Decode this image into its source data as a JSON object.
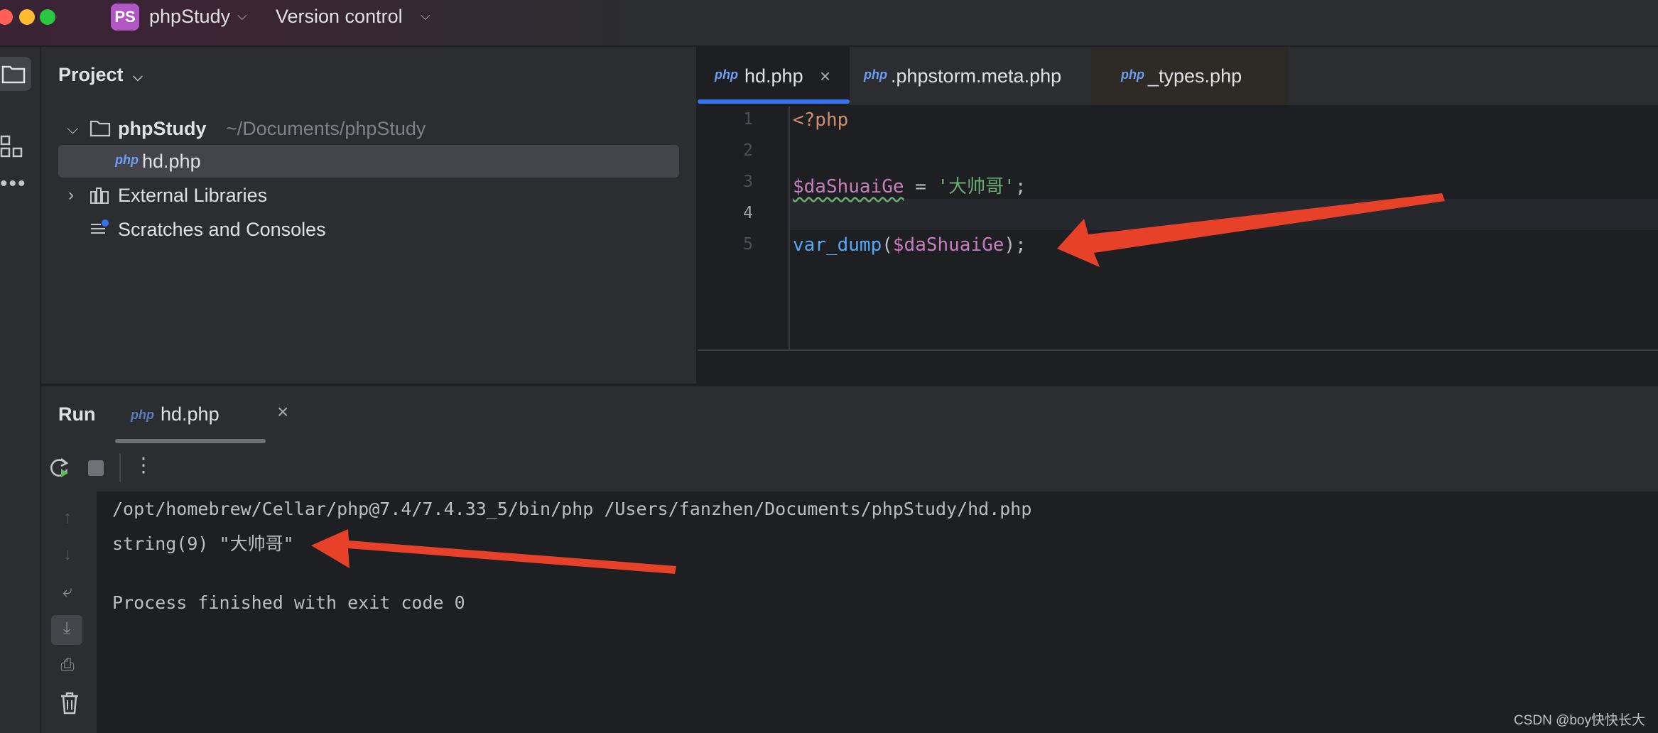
{
  "titlebar": {
    "project_badge": "PS",
    "project_name": "phpStudy",
    "vcs": "Version control"
  },
  "project_panel": {
    "title": "Project",
    "tree": {
      "root_name": "phpStudy",
      "root_path": "~/Documents/phpStudy",
      "file": "hd.php",
      "external": "External Libraries",
      "scratches": "Scratches and Consoles"
    }
  },
  "editor": {
    "tabs": [
      {
        "label": "hd.php",
        "active": true
      },
      {
        "label": ".phpstorm.meta.php",
        "active": false
      },
      {
        "label": "_types.php",
        "active": false
      }
    ],
    "file_icon_text": "php",
    "line_numbers": [
      "1",
      "2",
      "3",
      "4",
      "5"
    ],
    "code": {
      "line1": "<?php",
      "line3_var": "$daShuaiGe",
      "line3_op": " = ",
      "line3_str": "'大帅哥'",
      "line3_semi": ";",
      "line5_fn": "var_dump",
      "line5_open": "(",
      "line5_var": "$daShuaiGe",
      "line5_close": ");"
    }
  },
  "run_panel": {
    "title": "Run",
    "tab_label": "hd.php",
    "output": [
      "/opt/homebrew/Cellar/php@7.4/7.4.33_5/bin/php /Users/fanzhen/Documents/phpStudy/hd.php",
      "string(9) \"大帅哥\"",
      "",
      "Process finished with exit code 0"
    ]
  },
  "watermark": "CSDN @boy快快长大",
  "colors": {
    "accent": "#3574f0",
    "annotation_arrow": "#e8412a",
    "php_icon": "#6e9ef5",
    "keyword": "#cf8e6d",
    "variable": "#c77dbb",
    "string": "#6aab73",
    "function": "#56a8f5"
  }
}
